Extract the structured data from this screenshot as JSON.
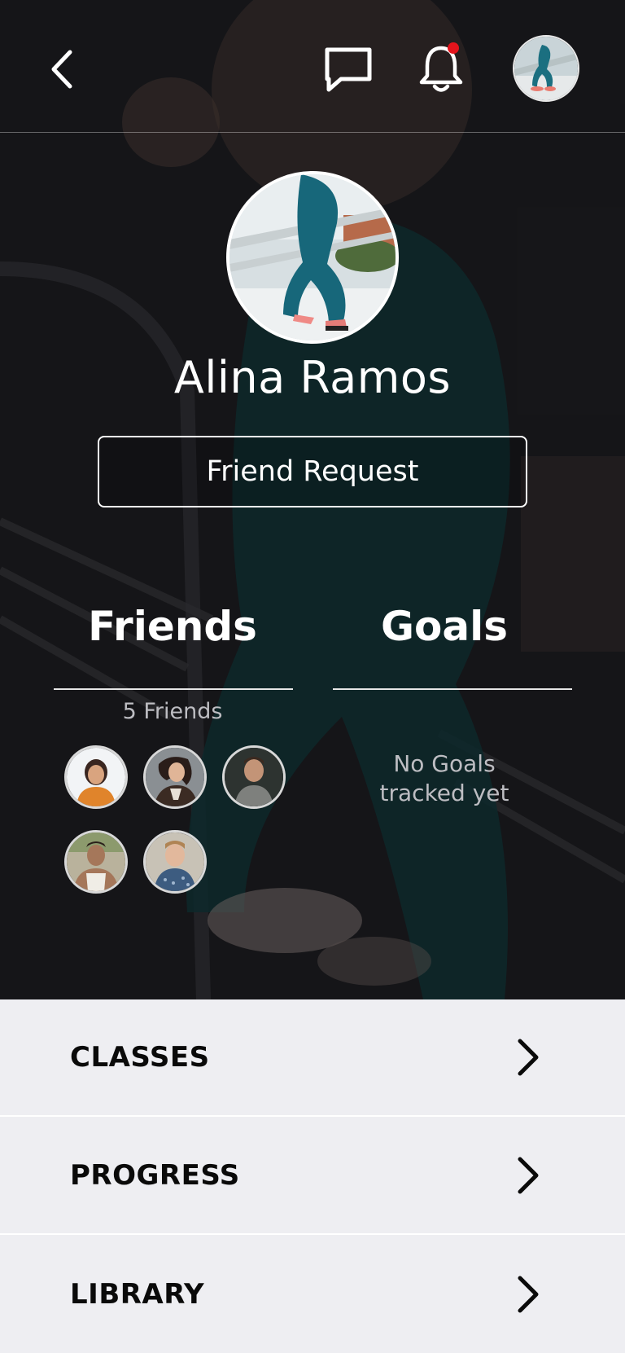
{
  "header": {
    "back_icon": "chevron-left-icon",
    "chat_icon": "chat-bubble-icon",
    "bell_icon": "bell-icon",
    "notification_dot_color": "#e4141c"
  },
  "profile": {
    "name": "Alina Ramos",
    "friend_request_label": "Friend Request"
  },
  "friends": {
    "title": "Friends",
    "count_label": "5 Friends",
    "avatars": [
      "friend-1",
      "friend-2",
      "friend-3",
      "friend-4",
      "friend-5"
    ]
  },
  "goals": {
    "title": "Goals",
    "empty_line1": "No Goals",
    "empty_line2": "tracked yet"
  },
  "menu": {
    "items": [
      {
        "label": "CLASSES",
        "icon": "chevron-right-icon"
      },
      {
        "label": "PROGRESS",
        "icon": "chevron-right-icon"
      },
      {
        "label": "LIBRARY",
        "icon": "chevron-right-icon"
      }
    ]
  }
}
